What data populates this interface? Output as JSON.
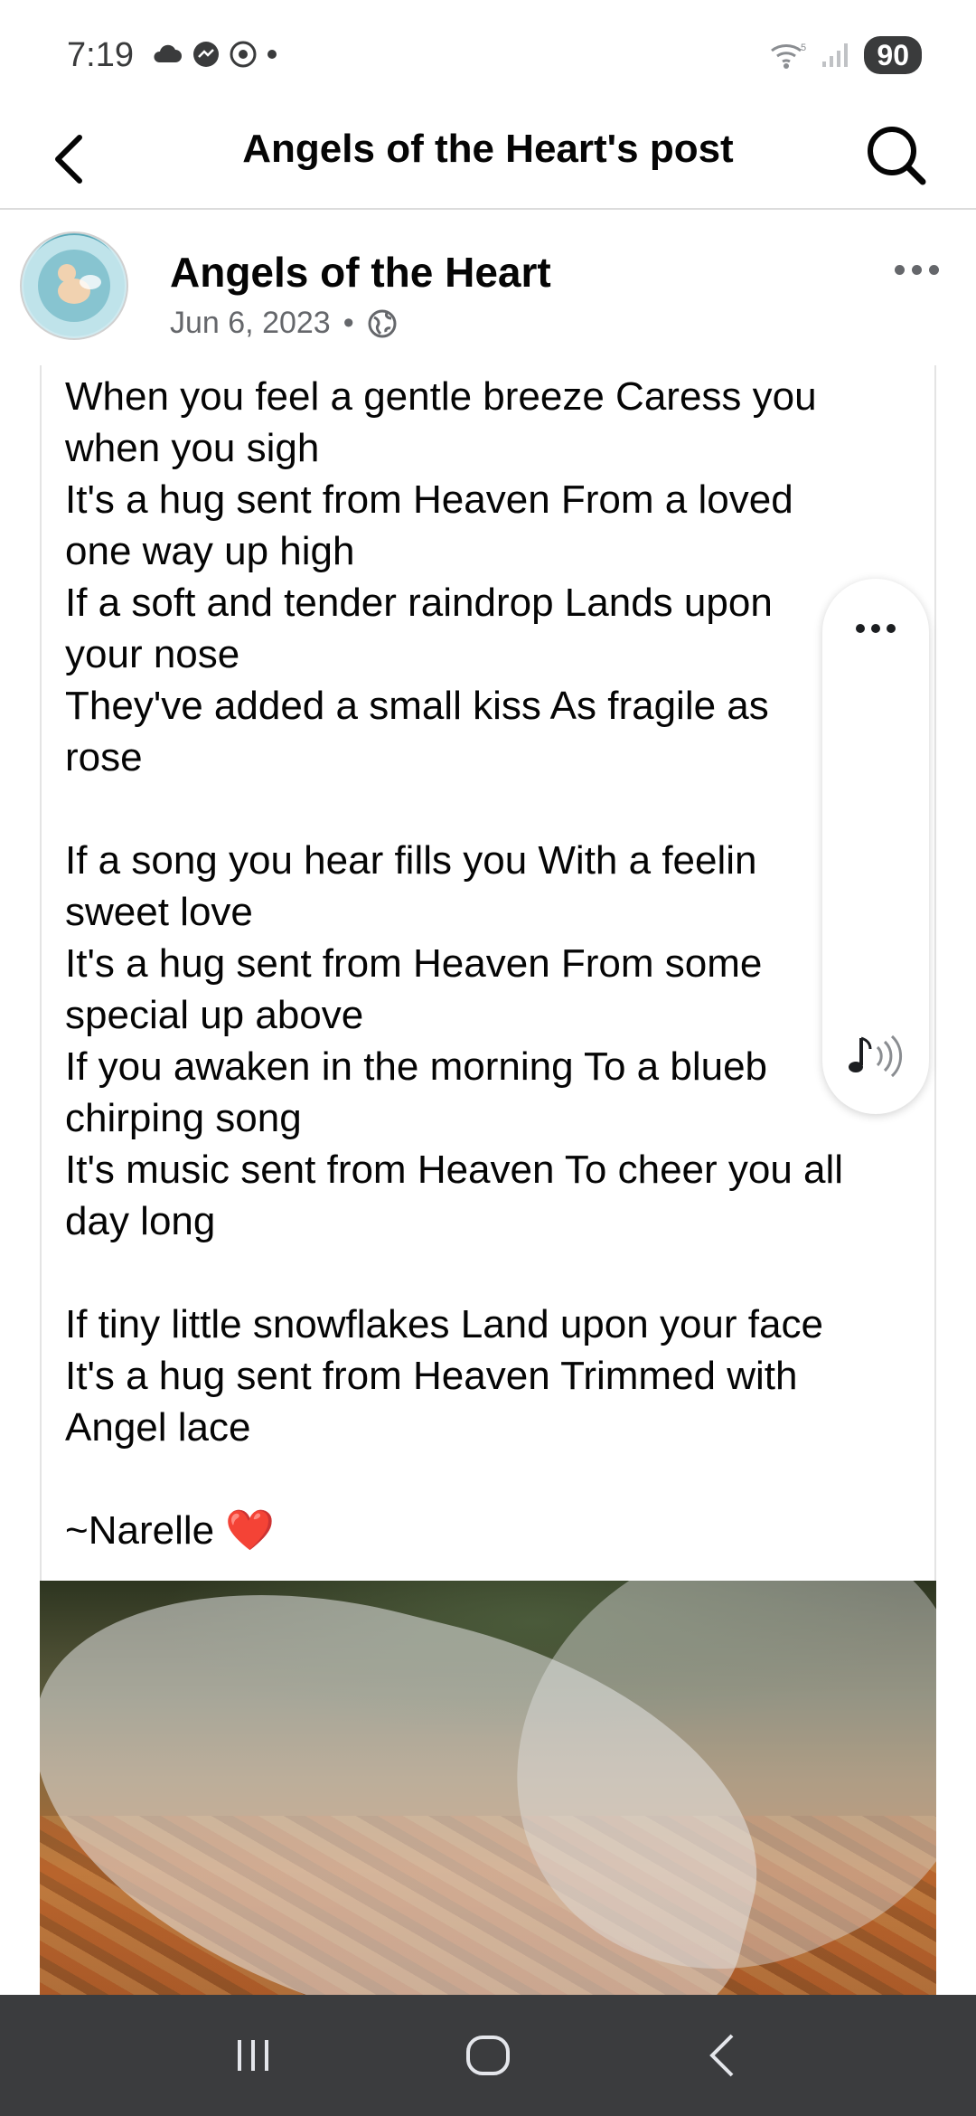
{
  "status_bar": {
    "time": "7:19",
    "battery": "90",
    "icons": [
      "cloud-icon",
      "messenger-icon",
      "chrome-icon",
      "dot-icon",
      "wifi-icon",
      "signal-icon"
    ]
  },
  "header": {
    "title": "Angels of the Heart's post",
    "back_icon": "chevron-left-icon",
    "search_icon": "search-icon"
  },
  "post": {
    "author": "Angels of the Heart",
    "date": "Jun 6, 2023",
    "separator": "•",
    "audience_icon": "globe-icon",
    "more_icon": "more-horizontal-icon",
    "poem_lines": [
      "When you feel a gentle breeze Caress you",
      "when you sigh",
      "It's a hug sent from Heaven From a loved",
      "one way up high",
      "If a soft and tender raindrop Lands upon",
      "your nose",
      "They've added a small kiss As fragile as",
      "rose",
      "",
      "If a song you hear fills you With a feelin",
      "sweet love",
      "It's a hug sent from Heaven From some",
      "special up above",
      "If you awaken in the morning To a blueb",
      "chirping song",
      "It's music sent from Heaven To cheer you all",
      "day long",
      "",
      "If tiny little snowflakes Land upon your face",
      "It's a hug sent from Heaven Trimmed with",
      "Angel lace",
      "",
      "~Narelle ❤️"
    ]
  },
  "side_panel": {
    "more_icon": "more-horizontal-icon",
    "audio_icon": "music-sound-icon"
  },
  "nav_bar": {
    "recent_icon": "recent-apps-icon",
    "home_icon": "home-icon",
    "back_icon": "back-icon"
  }
}
